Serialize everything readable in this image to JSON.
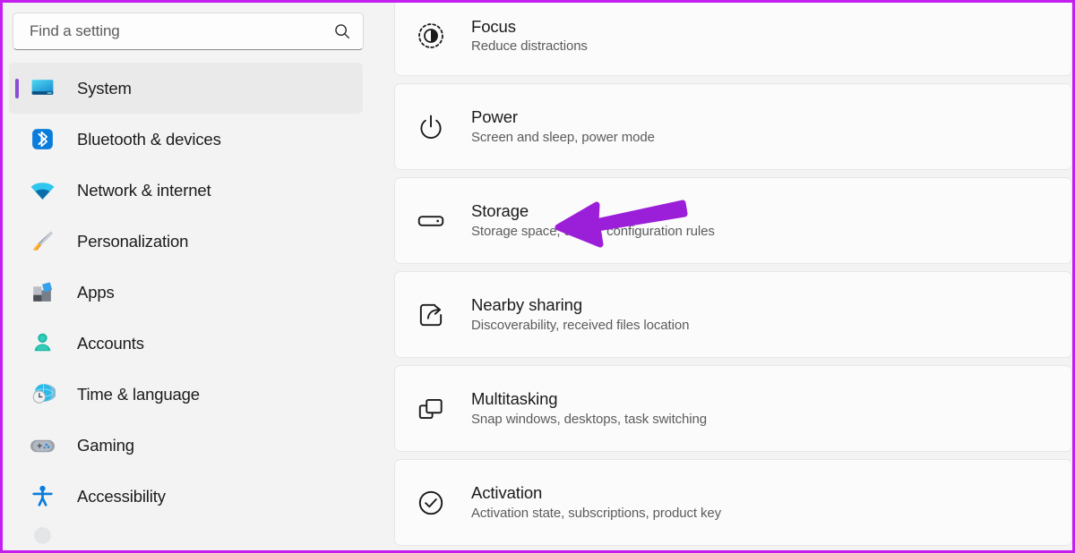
{
  "window": {
    "accent_border_color": "#c41ef0",
    "background_color": "#f3f3f3"
  },
  "search": {
    "placeholder": "Find a setting",
    "value": "",
    "icon": "search-icon"
  },
  "sidebar": {
    "selection_accent_color": "#8a4dd4",
    "items": [
      {
        "label": "System",
        "icon": "monitor-icon",
        "selected": true
      },
      {
        "label": "Bluetooth & devices",
        "icon": "bluetooth-icon",
        "selected": false
      },
      {
        "label": "Network & internet",
        "icon": "wifi-icon",
        "selected": false
      },
      {
        "label": "Personalization",
        "icon": "paintbrush-icon",
        "selected": false
      },
      {
        "label": "Apps",
        "icon": "apps-icon",
        "selected": false
      },
      {
        "label": "Accounts",
        "icon": "person-icon",
        "selected": false
      },
      {
        "label": "Time & language",
        "icon": "clock-globe-icon",
        "selected": false
      },
      {
        "label": "Gaming",
        "icon": "gamepad-icon",
        "selected": false
      },
      {
        "label": "Accessibility",
        "icon": "accessibility-icon",
        "selected": false
      }
    ]
  },
  "main": {
    "rows": [
      {
        "title": "Focus",
        "subtitle": "Reduce distractions",
        "icon": "focus-icon"
      },
      {
        "title": "Power",
        "subtitle": "Screen and sleep, power mode",
        "icon": "power-icon"
      },
      {
        "title": "Storage",
        "subtitle": "Storage space, drives, configuration rules",
        "icon": "storage-icon"
      },
      {
        "title": "Nearby sharing",
        "subtitle": "Discoverability, received files location",
        "icon": "share-icon"
      },
      {
        "title": "Multitasking",
        "subtitle": "Snap windows, desktops, task switching",
        "icon": "multitasking-icon"
      },
      {
        "title": "Activation",
        "subtitle": "Activation state, subscriptions, product key",
        "icon": "check-circle-icon"
      }
    ]
  },
  "annotation": {
    "type": "arrow",
    "direction": "left",
    "color": "#9b1fd8",
    "points_at": "Storage"
  }
}
